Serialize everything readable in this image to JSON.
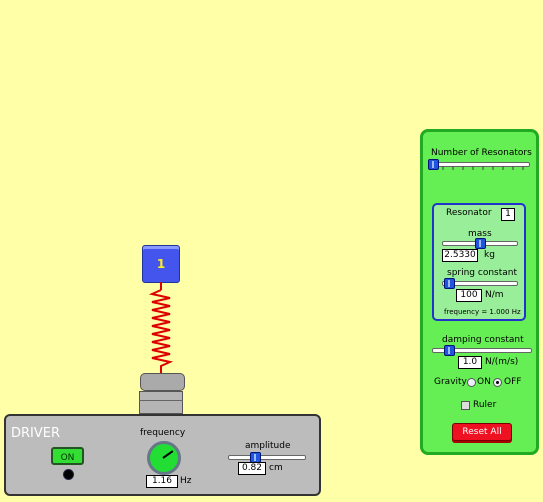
{
  "resonators": {
    "count_label": "Number of Resonators",
    "number": "1",
    "box_title": "Resonator",
    "box_number": "1",
    "mass_label": "mass",
    "mass_value": "2.5330",
    "mass_unit": "kg",
    "spring_label": "spring constant",
    "spring_value": "100",
    "spring_unit": "N/m",
    "frequency_text": "frequency = 1.000 Hz"
  },
  "damping": {
    "label": "damping constant",
    "value": "1.0",
    "unit": "N/(m/s)"
  },
  "gravity": {
    "label": "Gravity",
    "on": "ON",
    "off": "OFF",
    "selected": "OFF"
  },
  "ruler": {
    "label": "Ruler",
    "checked": false
  },
  "reset_label": "Reset All",
  "driver": {
    "title": "DRIVER",
    "on_label": "ON",
    "frequency_label": "frequency",
    "frequency_value": "1.16",
    "frequency_unit": "Hz",
    "amplitude_label": "amplitude",
    "amplitude_value": "0.82",
    "amplitude_unit": "cm"
  },
  "colors": {
    "background": "#ffffa8",
    "panel": "#66ee55",
    "spring": "#dd0000",
    "mass": "#4455ee",
    "reset": "#ee1122"
  }
}
